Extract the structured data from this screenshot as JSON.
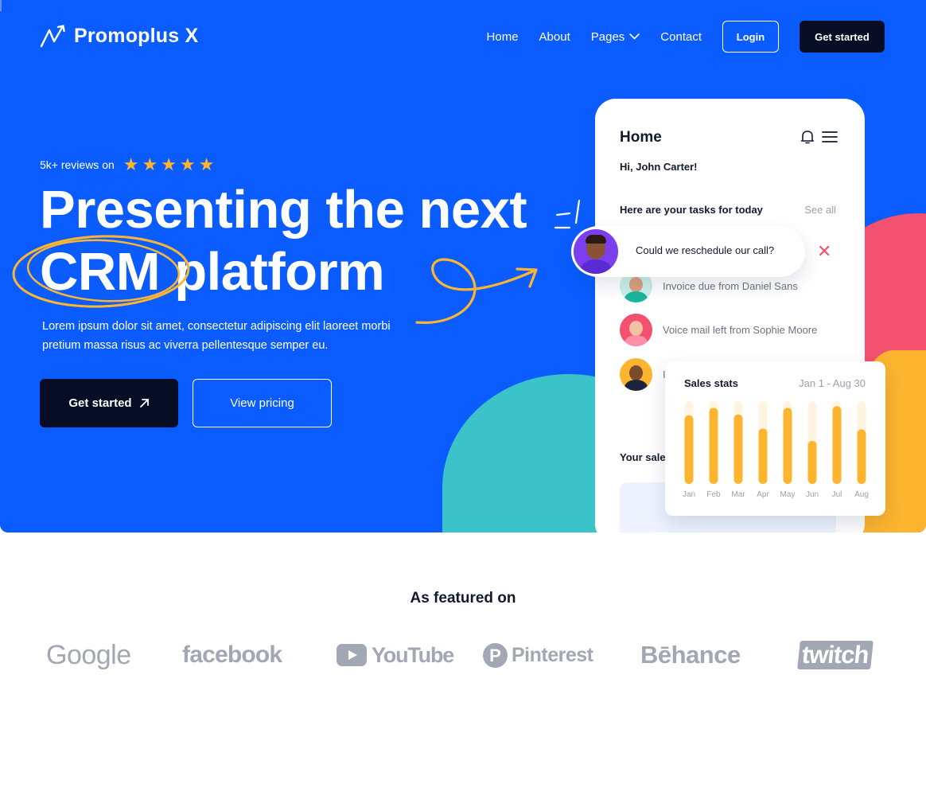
{
  "brand": {
    "name": "Promoplus X",
    "logo_icon": "trend-arrow-icon"
  },
  "nav": {
    "links": [
      "Home",
      "About",
      "Pages",
      "Contact"
    ],
    "login_label": "Login",
    "cta_label": "Get started"
  },
  "hero": {
    "reviews_text": "5k+ reviews on",
    "rating_stars": 5,
    "headline_line1": "Presenting the next",
    "headline_crm": "CRM",
    "headline_line2_rest": "platform",
    "description": "Lorem ipsum dolor sit amet, consectetur adipiscing elit laoreet morbi pretium massa risus ac viverra pellentesque semper eu.",
    "primary_button": "Get started",
    "secondary_button": "View pricing"
  },
  "phone": {
    "title": "Home",
    "greeting": "Hi, John Carter!",
    "tasks_title": "Here are your tasks for today",
    "see_all": "See all",
    "tasks": [
      {
        "text": "Invoice due from Daniel Sans"
      },
      {
        "text": "Voice mail left from Sophie Moore"
      },
      {
        "text": "I"
      }
    ],
    "sales_label": "Your sales"
  },
  "chat": {
    "message": "Could we reschedule our call?",
    "close_icon": "close-icon"
  },
  "stats": {
    "title": "Sales stats",
    "range": "Jan 1 - Aug 30"
  },
  "chart_data": {
    "type": "bar",
    "categories": [
      "Jan",
      "Feb",
      "Mar",
      "Apr",
      "May",
      "Jun",
      "Jul",
      "Aug"
    ],
    "values": [
      0.83,
      0.92,
      0.84,
      0.67,
      0.92,
      0.52,
      0.94,
      0.66
    ],
    "ylim": [
      0,
      1
    ],
    "colors": {
      "bar": "#fdb52f",
      "track": "#fff4e2"
    }
  },
  "featured": {
    "title": "As featured on",
    "brands": [
      "Google",
      "facebook",
      "YouTube",
      "Pinterest",
      "Bēhance",
      "twitch"
    ]
  },
  "colors": {
    "primary": "#0a5cff",
    "dark": "#060d24",
    "accent_yellow": "#fdb52f",
    "accent_pink": "#f4506f",
    "accent_teal": "#3cc3c9"
  }
}
